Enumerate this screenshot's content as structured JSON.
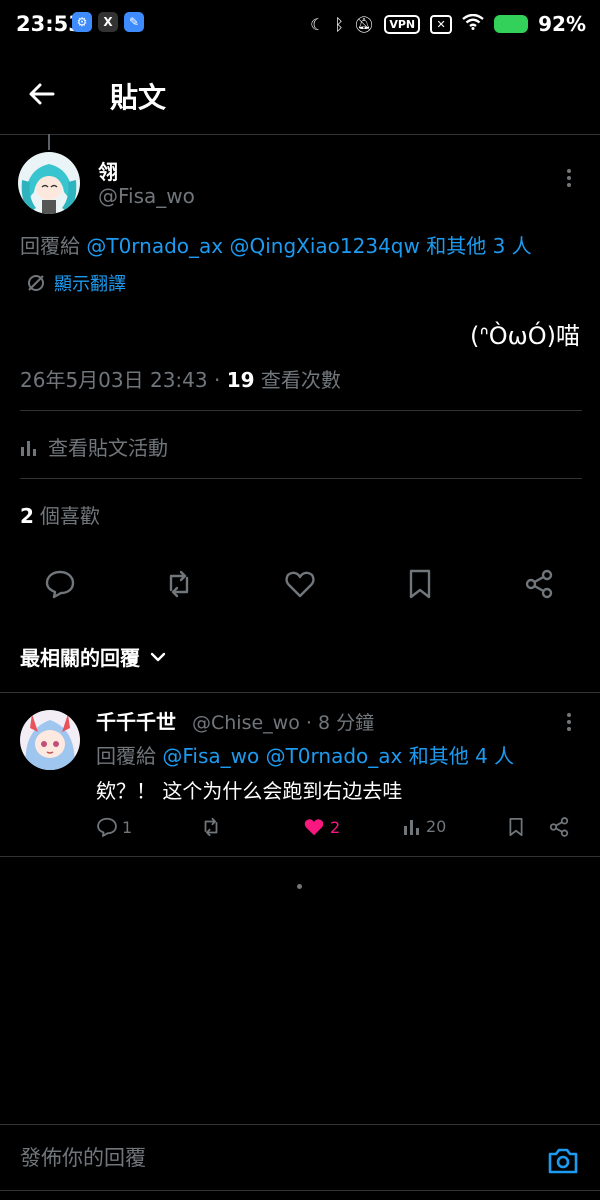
{
  "status_bar": {
    "time": "23:53",
    "apps": [
      {
        "icon": "gear-app-icon",
        "glyph": "⚙",
        "color": "#3d8bfd"
      },
      {
        "icon": "x-app-icon",
        "glyph": "𝕏",
        "color": "#222"
      },
      {
        "icon": "feather-app-icon",
        "glyph": "✎",
        "color": "#3d8bfd"
      }
    ],
    "vpn": "VPN",
    "battery": "92%"
  },
  "header": {
    "title": "貼文"
  },
  "post": {
    "author_name": "翎",
    "author_handle": "@Fisa_wo",
    "reply_prefix": "回覆給 ",
    "reply_mentions": "@T0rnado_ax @QingXiao1234qw 和其他 3 人",
    "translate": "顯示翻譯",
    "body": "(ᐢÒωÓ)喵",
    "timestamp": "26年5月03日 23:43 · ",
    "views_count": "19",
    "views_label": " 查看次數",
    "activity": "查看貼文活動",
    "likes_count": "2",
    "likes_label": "個喜歡"
  },
  "sort": {
    "label": "最相關的回覆"
  },
  "reply": {
    "name": "千千千世",
    "handle": "@Chise_wo · 8 分鐘",
    "reply_prefix": "回覆給 ",
    "reply_mentions": "@Fisa_wo @T0rnado_ax 和其他 4 人",
    "body": "欸？！ 这个为什么会跑到右边去哇",
    "comments": "1",
    "likes": "2",
    "views": "20"
  },
  "compose": {
    "placeholder": "發佈你的回覆"
  },
  "colors": {
    "accent": "#1d9bf0",
    "like": "#f91880",
    "muted": "#71767b",
    "battery": "#33d15a"
  }
}
